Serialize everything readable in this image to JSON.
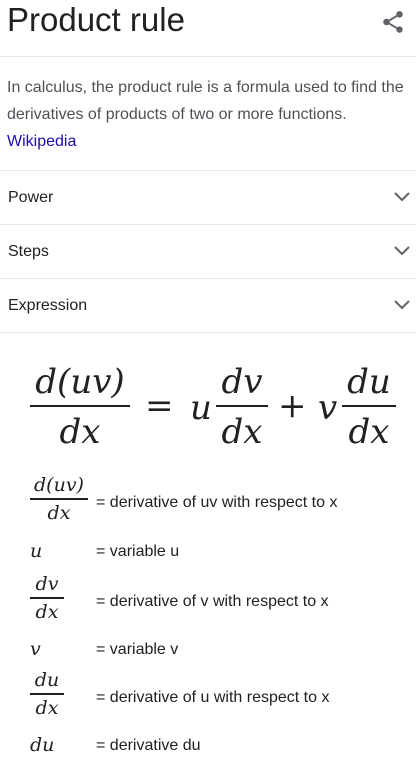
{
  "header": {
    "title": "Product rule",
    "share_icon": "share-icon"
  },
  "description": {
    "text": "In calculus, the product rule is a formula used to find the derivatives of products of two or more functions.",
    "source": "Wikipedia"
  },
  "accordion": [
    {
      "label": "Power"
    },
    {
      "label": "Steps"
    },
    {
      "label": "Expression"
    }
  ],
  "formula": {
    "lhs_num": "d(uv)",
    "lhs_den": "dx",
    "equals": "=",
    "u": "u",
    "dv": "dv",
    "dx1": "dx",
    "plus": "+",
    "v": "v",
    "du": "du",
    "dx2": "dx"
  },
  "legend": [
    {
      "num": "d(uv)",
      "den": "dx",
      "meaning": "= derivative of uv with respect to x"
    },
    {
      "symbol": "u",
      "meaning": "= variable u"
    },
    {
      "num": "dv",
      "den": "dx",
      "meaning": "= derivative of v with respect to x"
    },
    {
      "symbol": "v",
      "meaning": "= variable v"
    },
    {
      "num": "du",
      "den": "dx",
      "meaning": "= derivative of u with respect to x"
    },
    {
      "symbol": "du",
      "meaning": "= derivative du"
    }
  ]
}
